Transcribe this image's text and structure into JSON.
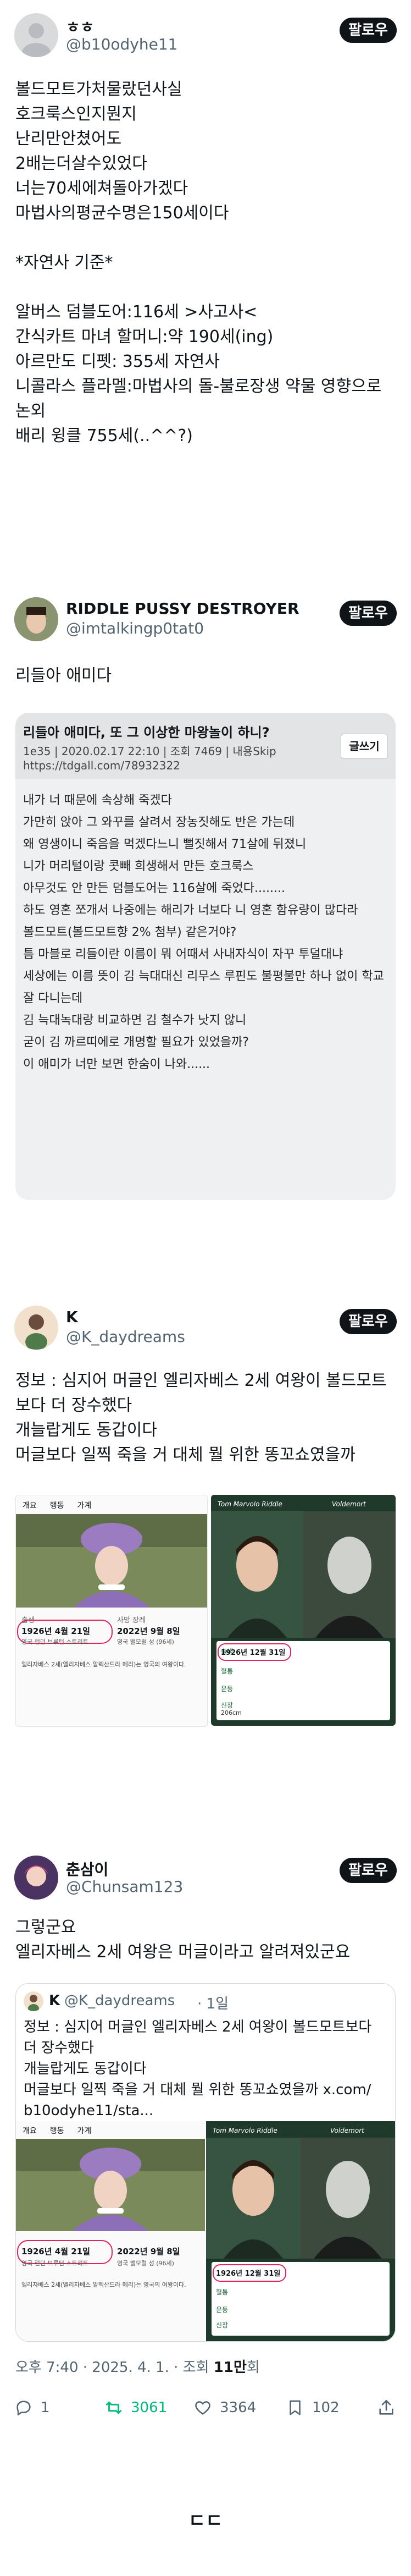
{
  "post1": {
    "name": "ㅎㅎ",
    "handle": "@b10odyhe11",
    "follow": "팔로우",
    "text": "볼드모트가처물랐던사실\n호크룩스인지뭔지\n난리만안쳤어도\n2배는더살수있었다\n너는70세에쳐돌아가겠다\n마법사의평균수명은150세이다\n\n*자연사 기준*\n\n알버스 덤블도어:116세 >사고사<\n간식카트 마녀 할머니:약 190세(ing)\n아르만도 디펫: 355세 자연사\n니콜라스 플라멜:마법사의 돌-불로장생 약물 영향으로 논외\n배리 윙클 755세(..^^?)"
  },
  "post2": {
    "name": "RIDDLE PUSSY DESTROYER",
    "handle": "@imtalkingp0tat0",
    "follow": "팔로우",
    "text": "리들아 애미다",
    "card": {
      "title": "리들아 애미다, 또 그 이상한 마왕놀이 하니?",
      "sub": "1e35 | 2020.02.17 22:10 | 조회 7469 | 내용Skip",
      "url": "https://tdgall.com/78932322",
      "button": "글쓰기",
      "lines": [
        "내가 너 때문에 속상해 죽겠다",
        "가만히 앉아 그 와꾸를 살려서 장농짓해도 반은 가는데",
        "왜 영생이니 죽음을 먹겠다느니 뻘짓해서 71살에 뒤졌니",
        "니가 머리털이랑 콧빼 희생해서 만든 호크룩스",
        "아무것도 안 만든 덤블도어는 116살에 죽었다........",
        "하도 영혼 쪼개서 나중에는 해리가 너보다 니 영혼 함유량이 많다라",
        "볼드모트(볼드모트향 2% 첨부) 같은거야?",
        "틈 마블로 리들이란 이름이 뭐 어때서 사내자식이 자꾸 투덜대냐",
        "세상에는 이름 뜻이 김 늑대대신 리무스 루핀도 불평불만 하나 없이 학교 잘 다니는데",
        "김 늑대녹대랑 비교하면 김 철수가 낫지 않니",
        "굳이 김 까르띠에로 개명할 필요가 있었을까?",
        "이 애미가 너만 보면 한숨이 나와......"
      ]
    }
  },
  "post3": {
    "name": "K",
    "handle": "@K_daydreams",
    "follow": "팔로우",
    "text": "정보 : 심지어 머글인 엘리자베스 2세 여왕이 볼드모트보다 더 장수했다\n개늘랍게도 동갑이다\n머글보다 일찍 죽을 거 대체 뭘 위한 똥꼬쇼였을까",
    "left_card": {
      "tabs": [
        "개요",
        "행동",
        "가계"
      ],
      "birth_label": "출생",
      "birth": "1926년 4월 21일",
      "birth_place": "영국 런던 브루턴 스트리트",
      "death_label": "사망 장례",
      "death": "2022년 9월 8일",
      "death_place": "영국 밸모럴 성 (96세)",
      "note": "엘리자베스 2세(엘리자베스 알렉산드라 메리)는 영국의 여왕이다."
    },
    "right_card": {
      "left_name": "Tom Marvolo Riddle",
      "right_name": "Voldemort",
      "row1_label": "출생",
      "row1_value": "1926년 12월 31일",
      "row2_label": "혈통",
      "row3_label": "운동",
      "row4_label": "신장",
      "row4_value": "206cm"
    }
  },
  "post4": {
    "name": "춘삼이",
    "handle": "@Chunsam123",
    "follow": "팔로우",
    "text": "그렇군요\n엘리자베스 2세 여왕은 머글이라고 알려져있군요",
    "quote": {
      "name": "K",
      "handle": "@K_daydreams",
      "time": "· 1일",
      "text": "정보 : 심지어 머글인 엘리자베스 2세 여왕이 볼드모트보다 더 장수했다\n개늘랍게도 동갑이다\n머글보다 일찍 죽을 거 대체 뭘 위한 똥꼬쇼였을까 x.com/\nb10odyhe11/sta..."
    },
    "meta": {
      "time": "오후 7:40 · 2025. 4. 1. · 조회 ",
      "views": "11만",
      "views_suffix": "회"
    },
    "actions": {
      "reply": "1",
      "retweet": "3061",
      "like": "3364",
      "bookmark": "102"
    }
  },
  "footer": "ㄷㄷ",
  "colors": {
    "retweet": "#00ba7c",
    "muted": "#536471",
    "text": "#0f1419",
    "underline_red": "#e0245e"
  }
}
